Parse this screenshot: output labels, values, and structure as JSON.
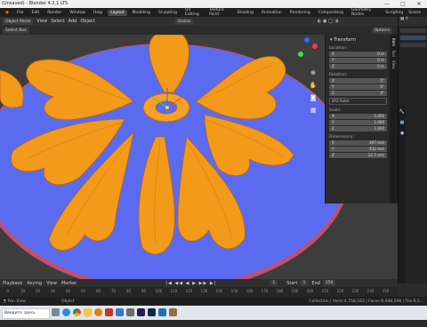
{
  "window": {
    "title": "(Unsaved) - Blender 4.2.1 LTS",
    "controls": [
      "—",
      "□",
      "✕"
    ]
  },
  "menubar": {
    "items": [
      "File",
      "Edit",
      "Render",
      "Window",
      "Help"
    ],
    "workspaces": [
      "Layout",
      "Modeling",
      "Sculpting",
      "UV Editing",
      "Texture Paint",
      "Shading",
      "Animation",
      "Rendering",
      "Compositing",
      "Geometry Nodes",
      "Scripting"
    ],
    "active_workspace": "Layout",
    "scene_label": "Scene"
  },
  "viewport_header": {
    "mode": "Object Mode",
    "menus": [
      "View",
      "Select",
      "Add",
      "Object"
    ],
    "orientation": "Global",
    "options_label": "Options",
    "select_mode": "Select Box"
  },
  "npanel": {
    "section": "Transform",
    "location": {
      "label": "Location:",
      "x": "0 m",
      "y": "0 m",
      "z": "0 m"
    },
    "rotation": {
      "label": "Rotation:",
      "x": "0°",
      "y": "0°",
      "z": "0°",
      "mode": "XYZ Euler"
    },
    "scale": {
      "label": "Scale:",
      "x": "1.000",
      "y": "1.000",
      "z": "1.000"
    },
    "dimensions": {
      "label": "Dimensions:",
      "x": "497 mm",
      "y": "412 mm",
      "z": "22.7 mm"
    },
    "tabs": [
      "Item",
      "Tool",
      "View"
    ]
  },
  "timeline": {
    "menus": [
      "Playback",
      "Keying",
      "View",
      "Marker"
    ],
    "current_frame": "1",
    "start_label": "Start",
    "start": "1",
    "end_label": "End",
    "end": "250",
    "ticks": [
      "0",
      "10",
      "20",
      "30",
      "40",
      "50",
      "60",
      "70",
      "80",
      "90",
      "100",
      "110",
      "120",
      "130",
      "140",
      "150",
      "160",
      "170",
      "180",
      "190",
      "200",
      "210",
      "220",
      "230",
      "240",
      "250"
    ]
  },
  "statusbar": {
    "left": "Pan View",
    "middle": "Object",
    "right": "Collection | Verts:4,758,163 | Faces:9,498,598 | Tris:9,5..."
  },
  "taskbar": {
    "search_placeholder": "Введите здесь запрос",
    "apps": [
      "task-view",
      "edge",
      "chrome",
      "explorer",
      "blender",
      "pdf",
      "store",
      "scissors",
      "premiere",
      "photoshop",
      "mail",
      "cube"
    ]
  },
  "colors": {
    "ornament": "#f39a1a",
    "disc": "#5b6bf0",
    "disc_rim": "#c0506b",
    "accent": "#4772b3"
  }
}
